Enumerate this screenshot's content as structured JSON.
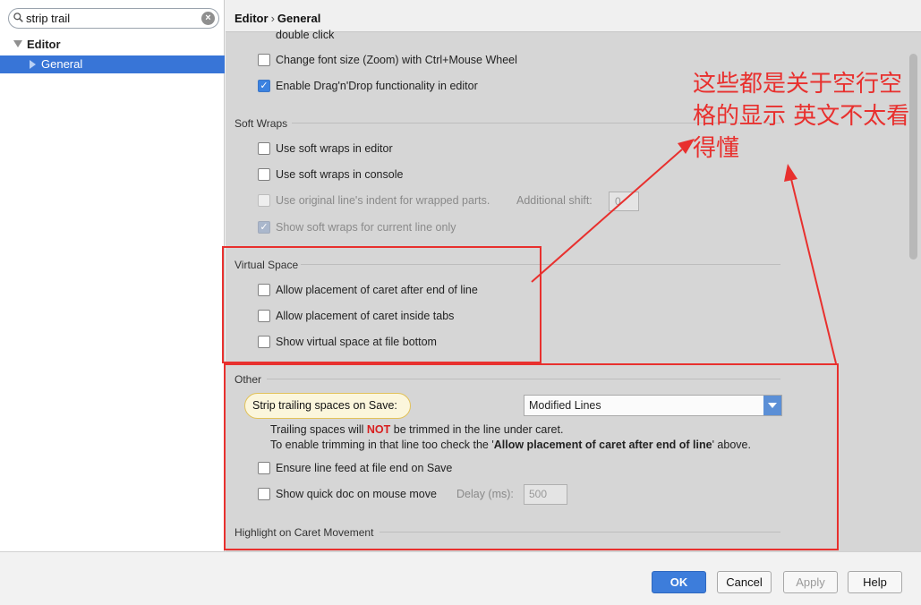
{
  "search": {
    "value": "strip trail"
  },
  "tree": {
    "editor": "Editor",
    "general": "General"
  },
  "breadcrumb": {
    "parent": "Editor",
    "separator": "›",
    "current": "General"
  },
  "options": {
    "truncated": "double click",
    "zoom": "Change font size (Zoom) with Ctrl+Mouse Wheel",
    "dragdrop": "Enable Drag'n'Drop functionality in editor"
  },
  "soft_wraps": {
    "title": "Soft Wraps",
    "editor": "Use soft wraps in editor",
    "console": "Use soft wraps in console",
    "indent": "Use original line's indent for wrapped parts.",
    "shift_label": "Additional shift:",
    "shift_value": "0",
    "current_only": "Show soft wraps for current line only"
  },
  "virtual_space": {
    "title": "Virtual Space",
    "after_eol": "Allow placement of caret after end of line",
    "inside_tabs": "Allow placement of caret inside tabs",
    "file_bottom": "Show virtual space at file bottom"
  },
  "other": {
    "title": "Other",
    "strip_label": "Strip trailing spaces on Save:",
    "strip_value": "Modified Lines",
    "note1_a": "Trailing spaces will ",
    "note1_b": "NOT",
    "note1_c": " be trimmed in the line under caret.",
    "note2_a": "To enable trimming in that line too check the '",
    "note2_b": "Allow placement of caret after end of line",
    "note2_c": "' above.",
    "line_feed": "Ensure line feed at file end on Save",
    "quick_doc": "Show quick doc on mouse move",
    "delay_label": "Delay (ms):",
    "delay_value": "500"
  },
  "highlight": {
    "title": "Highlight on Caret Movement"
  },
  "annotation": {
    "text": "这些都是关于空行空格的显示 英文不太看得懂"
  },
  "buttons": {
    "ok": "OK",
    "cancel": "Cancel",
    "apply": "Apply",
    "help": "Help"
  },
  "colors": {
    "selection": "#3875d7",
    "annotation": "#e8302e",
    "ok_button": "#3d7ddb"
  },
  "icons": {
    "search": "search-icon",
    "clear": "clear-icon",
    "expand": "triangle-icon"
  }
}
